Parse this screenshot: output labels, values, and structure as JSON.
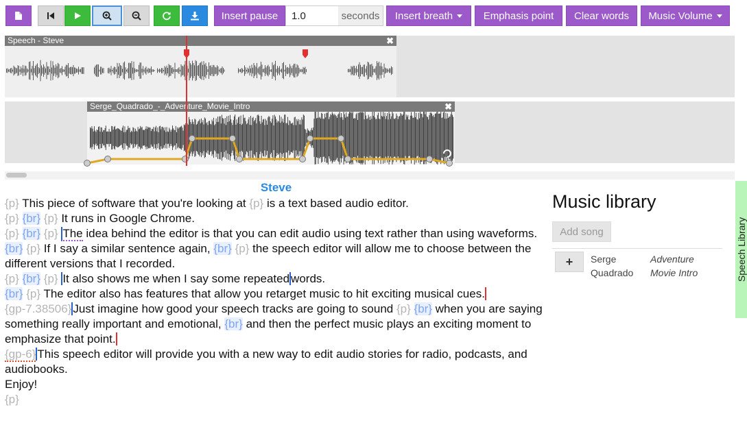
{
  "toolbar": {
    "insert_pause_label": "Insert pause",
    "pause_value": "1.0",
    "pause_unit": "seconds",
    "insert_breath_label": "Insert breath",
    "emphasis_label": "Emphasis point",
    "clear_words_label": "Clear words",
    "music_volume_label": "Music Volume"
  },
  "tracks": {
    "speech_clip_title": "Speech - Steve",
    "music_clip_title": "Serge_Quadrado_-_Adventure_Movie_Intro"
  },
  "transcript": {
    "speaker": "Steve",
    "tag_p": "{p}",
    "tag_br": "{br}",
    "gp_1": "{gp-7.38506}",
    "gp_2": "{gp-6}",
    "s1a": "This piece of software that you're looking at",
    "s1b": "is a text based audio editor.",
    "s2": "It runs in Google Chrome.",
    "s3a": "The",
    "s3b": "idea behind the editor is that you can edit audio using text rather than using waveforms.",
    "s4a": "If I say a similar sentence again,",
    "s4b": "the speech editor will allow me to choose between the different versions that I recorded.",
    "s5a": "It also shows me when I say some repeated",
    "s5b": "words.",
    "s6": "The editor also has features that allow you retarget music to hit exciting musical cues.",
    "s7a": "Just imagine how good your speech tracks are going to sound",
    "s7b": "when you are saying something really important and emotional,",
    "s7c": "and then the perfect music plays an exciting moment to emphasize that point.",
    "s8": "This speech editor will provide you with a new way to edit audio stories for radio, podcasts, and audiobooks.",
    "s9": "Enjoy!"
  },
  "library": {
    "title": "Music library",
    "add_song_label": "Add song",
    "songs": [
      {
        "artist": "Serge Quadrado",
        "artist_line1": "Serge",
        "artist_line2": "Quadrado",
        "title_line1": "Adventure",
        "title_line2": "Movie Intro"
      }
    ],
    "side_tab_label": "Speech Library"
  },
  "colors": {
    "accent_purple": "#9b59c9",
    "play_green": "#3dbb3d",
    "download_blue": "#2a8ae0",
    "speaker_blue": "#2a8ae0",
    "playhead_red": "#e03030",
    "volume_curve": "#e0a820"
  },
  "icons": [
    "file-icon",
    "skip-back-icon",
    "play-icon",
    "zoom-in-icon",
    "zoom-out-icon",
    "refresh-icon",
    "download-icon",
    "close-icon",
    "plus-icon",
    "marker-icon"
  ]
}
